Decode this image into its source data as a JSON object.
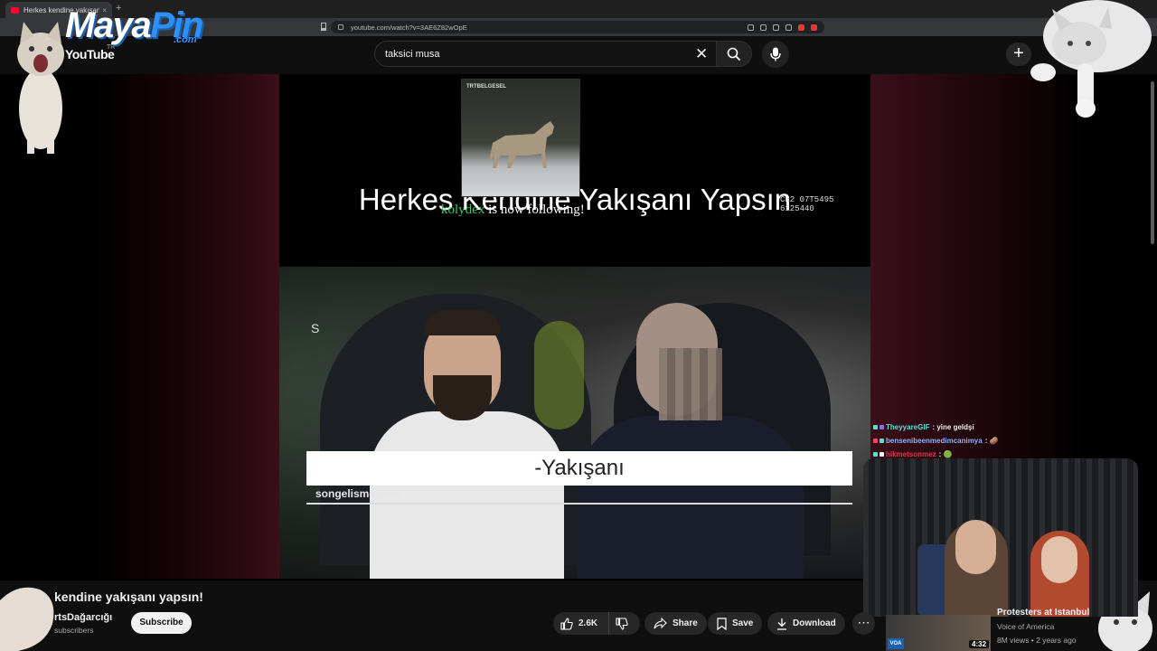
{
  "browser": {
    "tab_title": "Herkes kendine yakışanı yapsın",
    "tab_close": "×",
    "new_tab": "+",
    "url": "youtube.com/watch?v=3AE6Z82wOpE"
  },
  "youtube": {
    "logo_text": "YouTube",
    "region": "TR",
    "search_value": "taksici musa",
    "clear_symbol": "✕",
    "create_symbol": "+"
  },
  "overlay": {
    "brand_maya": "Maya",
    "brand_pin": "Pin",
    "brand_com": ".com",
    "trt_label": "TRTBELGESEL",
    "follow_user": "kolydex",
    "follow_text": " is now following!"
  },
  "video": {
    "title_text": "Herkes Kendine Yakışanı Yapsın",
    "cam_text": "CH2 07T5495 6125440",
    "side_mark": "S",
    "subtitle": "-Yakışanı",
    "watermark": "songelisme.com"
  },
  "chat": [
    {
      "user": "TheyyareGIF",
      "msg": ": yine geldşi",
      "color": "#56e0d8"
    },
    {
      "user": "bensenibeenmedimcanimya",
      "msg": ": 🥔",
      "color": "#8ab4ff"
    },
    {
      "user": "hikmetsonmez",
      "msg": ": 🟢",
      "color": "#e0304a"
    }
  ],
  "below": {
    "title": "kendine yakışanı yapsın!",
    "channel": "rtsDağarcığı",
    "subscribers": "subscribers",
    "subscribe_label": "Subscribe",
    "likes": "2.6K",
    "share_label": "Share",
    "save_label": "Save",
    "download_label": "Download",
    "more_symbol": "⋯"
  },
  "recommendation": {
    "title": "Protesters at Istanbul",
    "channel": "Voice of America",
    "meta": "8M views • 2 years ago",
    "duration": "4:32",
    "logo": "VOA"
  }
}
